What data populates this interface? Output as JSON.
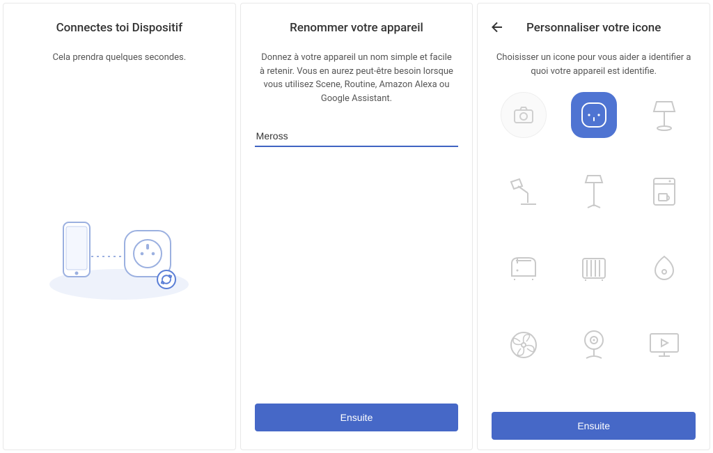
{
  "screen1": {
    "title": "Connectes toi Dispositif",
    "subtitle": "Cela prendra quelques secondes."
  },
  "screen2": {
    "title": "Renommer votre appareil",
    "subtitle": "Donnez à votre appareil un nom simple et facile à retenir. Vous en aurez peut-être besoin lorsque vous utilisez Scene, Routine, Amazon Alexa ou Google Assistant.",
    "input_value": "Meross",
    "button": "Ensuite"
  },
  "screen3": {
    "title": "Personnaliser votre icone",
    "subtitle": "Choisisser un icone pour vous aider a identifier a quoi votre appareil est identifie.",
    "button": "Ensuite",
    "icons": [
      "camera",
      "smart-plug",
      "table-lamp",
      "desk-lamp",
      "floor-lamp",
      "coffee-maker",
      "toaster",
      "radiator",
      "humidifier",
      "fan",
      "webcam",
      "tv"
    ],
    "selected_index": 1
  }
}
